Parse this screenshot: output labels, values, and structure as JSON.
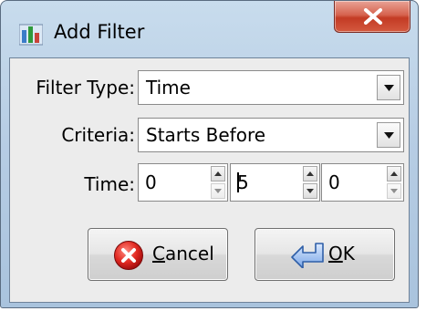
{
  "window": {
    "title": "Add Filter",
    "icons": {
      "app": "bar-chart-icon",
      "close": "close-x-icon"
    },
    "colors": {
      "close": "#c9432c",
      "titlebar": "#b9cfe6",
      "client": "#ececec"
    }
  },
  "form": {
    "filter_type": {
      "label": "Filter Type:",
      "value": "Time"
    },
    "criteria": {
      "label": "Criteria:",
      "value": "Starts Before"
    },
    "time": {
      "label": "Time:",
      "hours": "0",
      "minutes": "5",
      "seconds": "0"
    }
  },
  "buttons": {
    "cancel": {
      "mnemonic": "C",
      "rest": "ancel",
      "icon": "cancel-icon"
    },
    "ok": {
      "mnemonic": "O",
      "rest": "K",
      "icon": "return-arrow-icon"
    }
  }
}
